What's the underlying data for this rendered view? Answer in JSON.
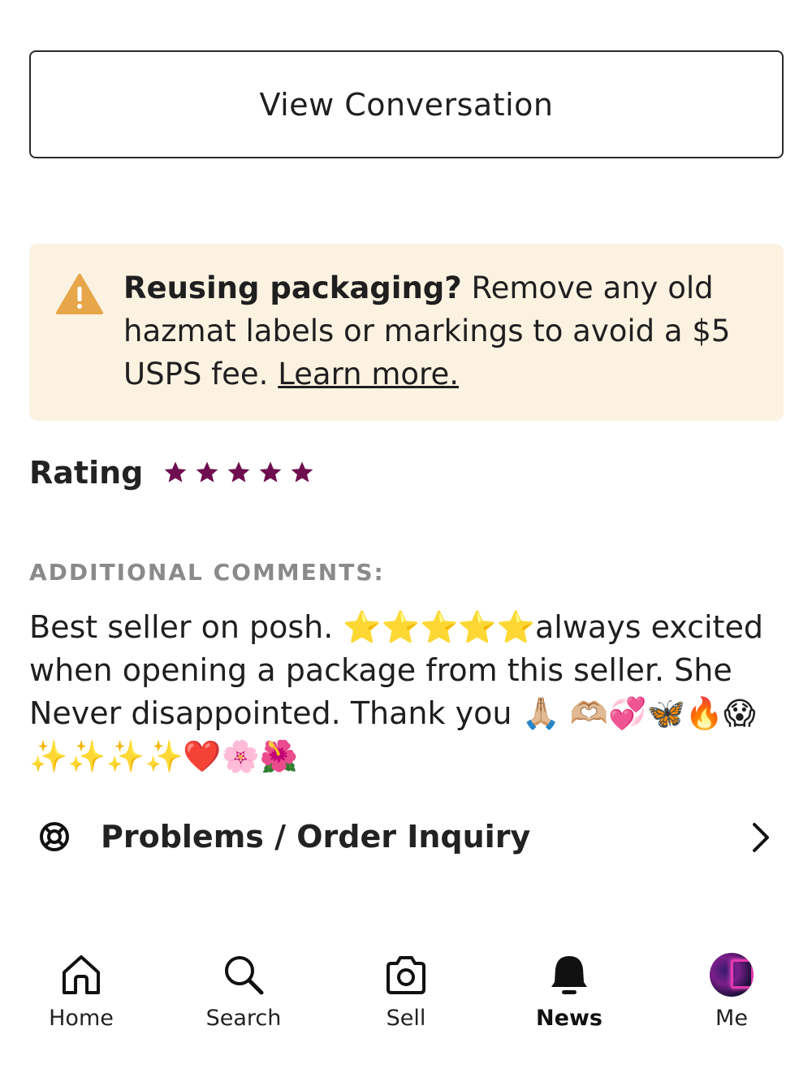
{
  "view_conversation_label": "View Conversation",
  "notice": {
    "bold": "Reusing packaging?",
    "text": " Remove any old hazmat labels or markings to avoid a $5 USPS fee. ",
    "link": "Learn more.",
    "icon": "warning-triangle-icon",
    "bg_color": "#fcf2e1",
    "icon_color": "#e8a64a"
  },
  "rating": {
    "label": "Rating",
    "stars": 5,
    "max_stars": 5,
    "star_color": "#6e0e4f"
  },
  "comments": {
    "title": "ADDITIONAL COMMENTS:",
    "body": "Best seller on posh. ⭐⭐⭐⭐⭐always excited when opening a package from this seller. She Never disappointed. Thank you 🙏🏼 🫶🏼💞🦋🔥😱✨✨✨✨❤️🌸🌺"
  },
  "problems": {
    "label": "Problems / Order Inquiry",
    "icon": "lifebuoy-icon",
    "chevron": "chevron-right-icon"
  },
  "nav": {
    "items": [
      {
        "label": "Home",
        "icon": "home-icon",
        "active": false
      },
      {
        "label": "Search",
        "icon": "search-icon",
        "active": false
      },
      {
        "label": "Sell",
        "icon": "camera-icon",
        "active": false
      },
      {
        "label": "News",
        "icon": "bell-icon",
        "active": true
      },
      {
        "label": "Me",
        "icon": "avatar",
        "active": false
      }
    ]
  }
}
